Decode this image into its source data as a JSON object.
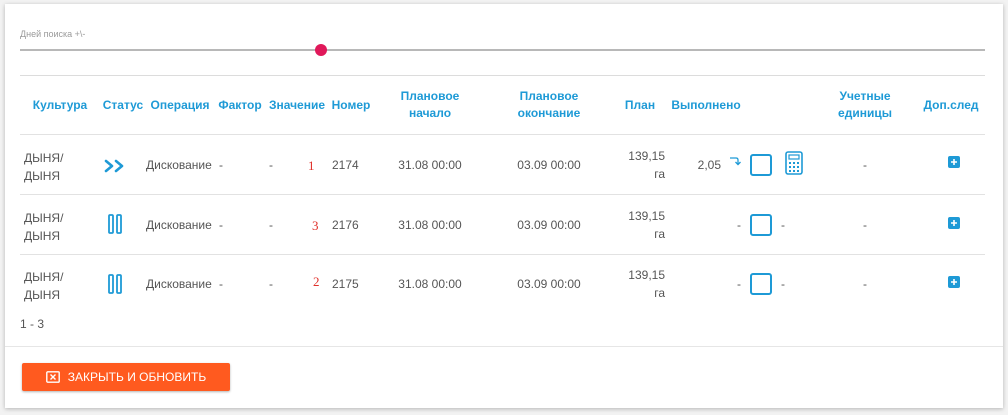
{
  "slider": {
    "label": "Дней поиска +\\-",
    "value_fraction": 0.305
  },
  "columns": {
    "culture": "Культура",
    "status": "Статус",
    "operation": "Операция",
    "fact": "Фактор",
    "value": "Значение",
    "number": "Номер",
    "plan_start": "Плановое начало",
    "plan_end": "Плановое окончание",
    "plan": "План",
    "done": "Выполнено",
    "units": "Учетные единицы",
    "extra": "Доп.след"
  },
  "rows": [
    {
      "culture": "ДЫНЯ/ ДЫНЯ",
      "status": "forward",
      "operation": "Дискование",
      "fact": "-",
      "value": "-",
      "order_mark": "1",
      "number": "2174",
      "plan_start": "31.08 00:00",
      "plan_end": "03.09 00:00",
      "plan_value": "139,15",
      "plan_unit": "га",
      "done_value": "2,05",
      "done_after": "",
      "units": "-"
    },
    {
      "culture": "ДЫНЯ/ ДЫНЯ",
      "status": "paused",
      "operation": "Дискование",
      "fact": "-",
      "value": "-",
      "order_mark": "3",
      "number": "2176",
      "plan_start": "31.08 00:00",
      "plan_end": "03.09 00:00",
      "plan_value": "139,15",
      "plan_unit": "га",
      "done_value": "-",
      "done_after": "-",
      "units": "-"
    },
    {
      "culture": "ДЫНЯ/ ДЫНЯ",
      "status": "paused",
      "operation": "Дискование",
      "fact": "-",
      "value": "-",
      "order_mark": "2",
      "number": "2175",
      "plan_start": "31.08 00:00",
      "plan_end": "03.09 00:00",
      "plan_value": "139,15",
      "plan_unit": "га",
      "done_value": "-",
      "done_after": "-",
      "units": "-"
    }
  ],
  "pager": "1 - 3",
  "footer": {
    "close_button": "ЗАКРЫТЬ И ОБНОВИТЬ"
  },
  "colors": {
    "accent": "#1e9ad6",
    "slider_thumb": "#e0185a",
    "button": "#ff5a1f",
    "order_mark": "#e0302a"
  },
  "icons": {
    "status_forward": "chevrons-right-icon",
    "status_paused": "pause-icon",
    "redo": "redo-arrow-icon",
    "calculator": "calculator-icon",
    "extra": "plus-square-icon",
    "close": "close-box-icon"
  }
}
